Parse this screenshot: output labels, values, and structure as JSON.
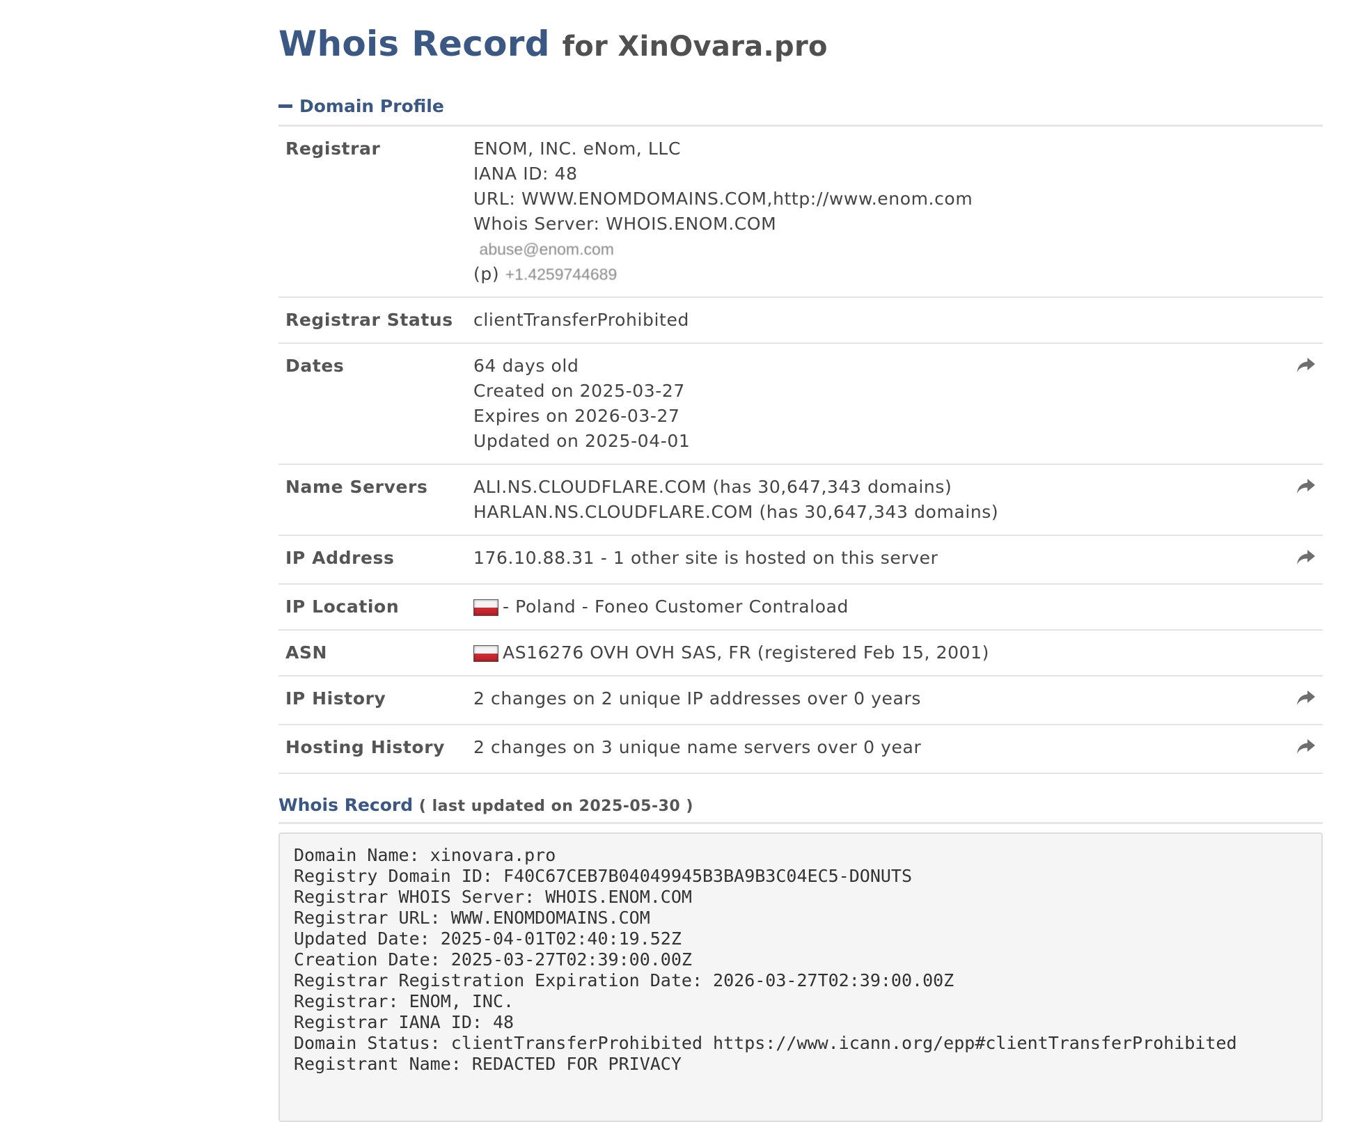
{
  "page": {
    "title": "Whois Record",
    "title_for": "for XinOvara.pro"
  },
  "profile": {
    "section_label": "Domain Profile",
    "registrar": {
      "label": "Registrar",
      "name": "ENOM, INC. eNom, LLC",
      "iana": "IANA ID: 48",
      "url": "URL: WWW.ENOMDOMAINS.COM,http://www.enom.com",
      "whois_server": "Whois Server: WHOIS.ENOM.COM",
      "email": "abuse@enom.com",
      "phone_prefix": "(p)",
      "phone": "+1.4259744689"
    },
    "registrar_status": {
      "label": "Registrar Status",
      "value": "clientTransferProhibited"
    },
    "dates": {
      "label": "Dates",
      "age": "64 days old",
      "created": "Created on 2025-03-27",
      "expires": "Expires on 2026-03-27",
      "updated": "Updated on 2025-04-01"
    },
    "name_servers": {
      "label": "Name Servers",
      "ns1": "ALI.NS.CLOUDFLARE.COM (has 30,647,343 domains)",
      "ns2": "HARLAN.NS.CLOUDFLARE.COM (has 30,647,343 domains)"
    },
    "ip_address": {
      "label": "IP Address",
      "value": "176.10.88.31 - 1 other site is hosted on this server"
    },
    "ip_location": {
      "label": "IP Location",
      "value": "- Poland - Foneo Customer Contraload"
    },
    "asn": {
      "label": "ASN",
      "value": "AS16276 OVH OVH SAS, FR (registered Feb 15, 2001)"
    },
    "ip_history": {
      "label": "IP History",
      "value": "2 changes on 2 unique IP addresses over 0 years"
    },
    "hosting_history": {
      "label": "Hosting History",
      "value": "2 changes on 3 unique name servers over 0 year"
    }
  },
  "whois_record": {
    "label": "Whois Record",
    "updated": "( last updated on 2025-05-30 )",
    "raw": "Domain Name: xinovara.pro\nRegistry Domain ID: F40C67CEB7B04049945B3BA9B3C04EC5-DONUTS\nRegistrar WHOIS Server: WHOIS.ENOM.COM\nRegistrar URL: WWW.ENOMDOMAINS.COM\nUpdated Date: 2025-04-01T02:40:19.52Z\nCreation Date: 2025-03-27T02:39:00.00Z\nRegistrar Registration Expiration Date: 2026-03-27T02:39:00.00Z\nRegistrar: ENOM, INC.\nRegistrar IANA ID: 48\nDomain Status: clientTransferProhibited https://www.icann.org/epp#clientTransferProhibited\nRegistrant Name: REDACTED FOR PRIVACY"
  },
  "icons": {
    "share": "share-arrow-icon",
    "collapse": "minus-icon",
    "flag": "poland-flag-icon"
  }
}
